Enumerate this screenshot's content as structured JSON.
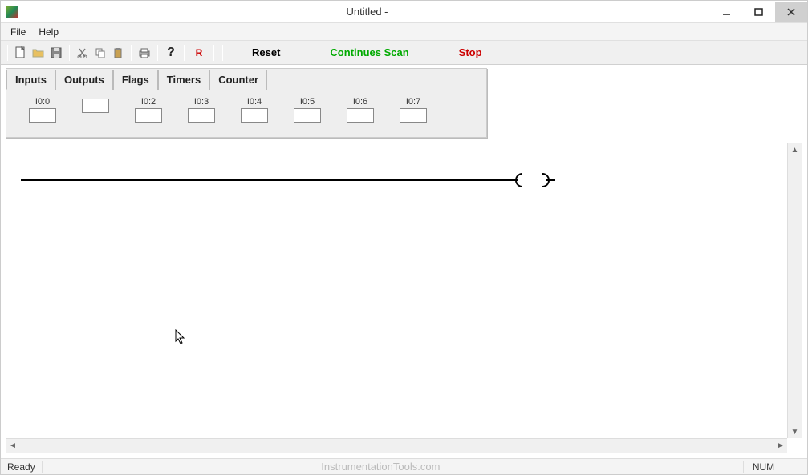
{
  "window": {
    "title": "Untitled -"
  },
  "menu": {
    "file": "File",
    "help": "Help"
  },
  "toolbar": {
    "reset": "Reset",
    "scan": "Continues Scan",
    "stop": "Stop",
    "r": "R"
  },
  "tabs": {
    "inputs": "Inputs",
    "outputs": "Outputs",
    "flags": "Flags",
    "timers": "Timers",
    "counter": "Counter"
  },
  "inputs": [
    {
      "label": "I0:0"
    },
    {
      "label": ""
    },
    {
      "label": "I0:2"
    },
    {
      "label": "I0:3"
    },
    {
      "label": "I0:4"
    },
    {
      "label": "I0:5"
    },
    {
      "label": "I0:6"
    },
    {
      "label": "I0:7"
    }
  ],
  "status": {
    "ready": "Ready",
    "watermark": "InstrumentationTools.com",
    "num": "NUM"
  },
  "colors": {
    "scan": "#00aa00",
    "stop": "#cc0000"
  }
}
